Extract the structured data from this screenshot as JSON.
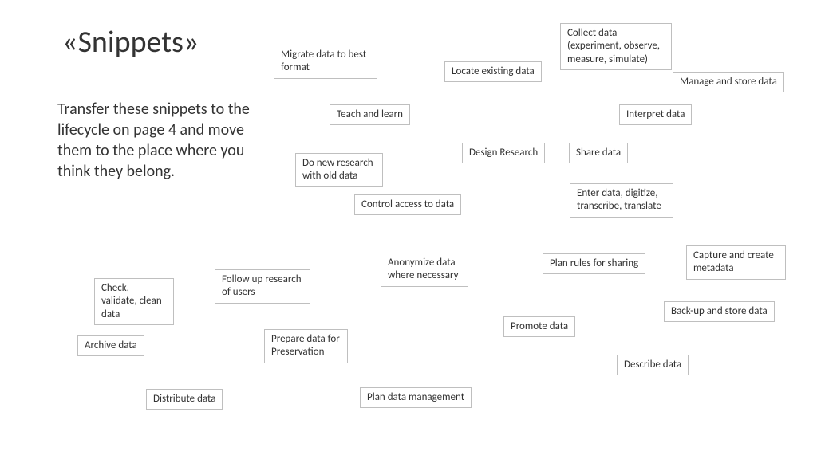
{
  "title": "«Snippets»",
  "instructions": "Transfer these snippets to the lifecycle on page 4 and move them to the place where you think they belong.",
  "snippets": {
    "migrate": "Migrate data to best format",
    "collect": "Collect data (experiment, observe, measure, simulate)",
    "locate": "Locate existing data",
    "manage": "Manage and store data",
    "teach": "Teach and learn",
    "interpret": "Interpret data",
    "newresearch": "Do new research with old data",
    "design": "Design Research",
    "share": "Share data",
    "control": "Control access to data",
    "enter": "Enter data, digitize, transcribe, translate",
    "anonymize": "Anonymize data where necessary",
    "planrules": "Plan rules for sharing",
    "capture": "Capture and create metadata",
    "check": "Check, validate, clean data",
    "followup": "Follow up research of users",
    "backup": "Back-up and store data",
    "archive": "Archive data",
    "prepare": "Prepare data for Preservation",
    "promote": "Promote data",
    "describe": "Describe data",
    "distribute": "Distribute data",
    "planmgmt": "Plan data management"
  }
}
